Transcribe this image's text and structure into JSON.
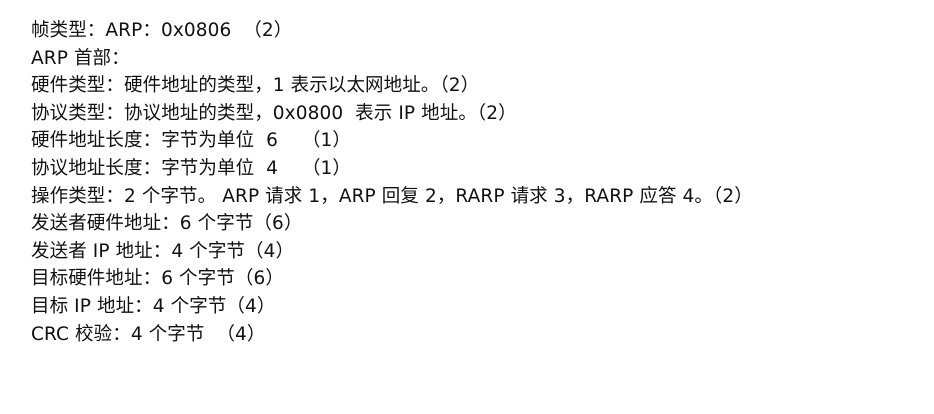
{
  "document": {
    "lines": [
      "帧类型：ARP：0x0806  （2）",
      "ARP 首部：",
      "硬件类型：硬件地址的类型，1 表示以太网地址。（2）",
      "协议类型：协议地址的类型，0x0800  表示 IP 地址。（2）",
      "硬件地址长度：字节为单位  6    （1）",
      "协议地址长度：字节为单位  4    （1）",
      "操作类型：2 个字节。 ARP 请求 1，ARP 回复 2，RARP 请求 3，RARP 应答 4。（2）",
      "发送者硬件地址：6 个字节（6）",
      "发送者 IP 地址：4 个字节（4）",
      "目标硬件地址：6 个字节（6）",
      "目标 IP 地址：4 个字节（4）",
      "CRC 校验：4 个字节  （4）"
    ]
  }
}
